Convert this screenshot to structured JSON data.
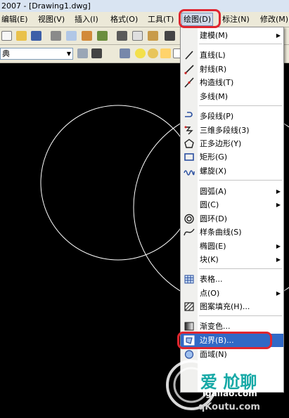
{
  "window": {
    "title": "2007 - [Drawing1.dwg]"
  },
  "menubar": {
    "items": [
      "编辑(E)",
      "视图(V)",
      "插入(I)",
      "格式(O)",
      "工具(T)",
      "绘图(D)",
      "标注(N)",
      "修改(M)"
    ],
    "active_index": 5
  },
  "toolbar": {
    "combo_value": "典"
  },
  "draw_menu": {
    "items": [
      {
        "label": "建模(M)",
        "submenu": true,
        "icon": "none"
      },
      {
        "label": "直线(L)",
        "icon": "line-icon"
      },
      {
        "label": "射线(R)",
        "icon": "ray-icon"
      },
      {
        "label": "构造线(T)",
        "icon": "construction-line-icon"
      },
      {
        "label": "多线(M)",
        "icon": "none"
      },
      {
        "label": "多段线(P)",
        "icon": "polyline-icon"
      },
      {
        "label": "三维多段线(3)",
        "icon": "3d-polyline-icon"
      },
      {
        "label": "正多边形(Y)",
        "icon": "polygon-icon"
      },
      {
        "label": "矩形(G)",
        "icon": "rectangle-icon"
      },
      {
        "label": "螺旋(X)",
        "icon": "helix-icon"
      },
      {
        "label": "圆弧(A)",
        "submenu": true,
        "icon": "none"
      },
      {
        "label": "圆(C)",
        "submenu": true,
        "icon": "none"
      },
      {
        "label": "圆环(D)",
        "icon": "donut-icon"
      },
      {
        "label": "样条曲线(S)",
        "icon": "spline-icon"
      },
      {
        "label": "椭圆(E)",
        "submenu": true,
        "icon": "none"
      },
      {
        "label": "块(K)",
        "submenu": true,
        "icon": "none"
      },
      {
        "label": "表格...",
        "icon": "table-icon"
      },
      {
        "label": "点(O)",
        "submenu": true,
        "icon": "none"
      },
      {
        "label": "图案填充(H)...",
        "icon": "hatch-icon"
      },
      {
        "label": "渐变色...",
        "icon": "gradient-icon"
      },
      {
        "label": "边界(B)...",
        "icon": "boundary-icon",
        "highlighted": true
      },
      {
        "label": "面域(N)",
        "icon": "region-icon"
      }
    ]
  },
  "watermark": {
    "line1": "爱 尬聊",
    "line2": "igaliao.com",
    "line3": "qKoutu.com"
  },
  "colors": {
    "highlight": "#3169c6",
    "annotation_red": "#e0262f",
    "canvas": "#000000"
  }
}
